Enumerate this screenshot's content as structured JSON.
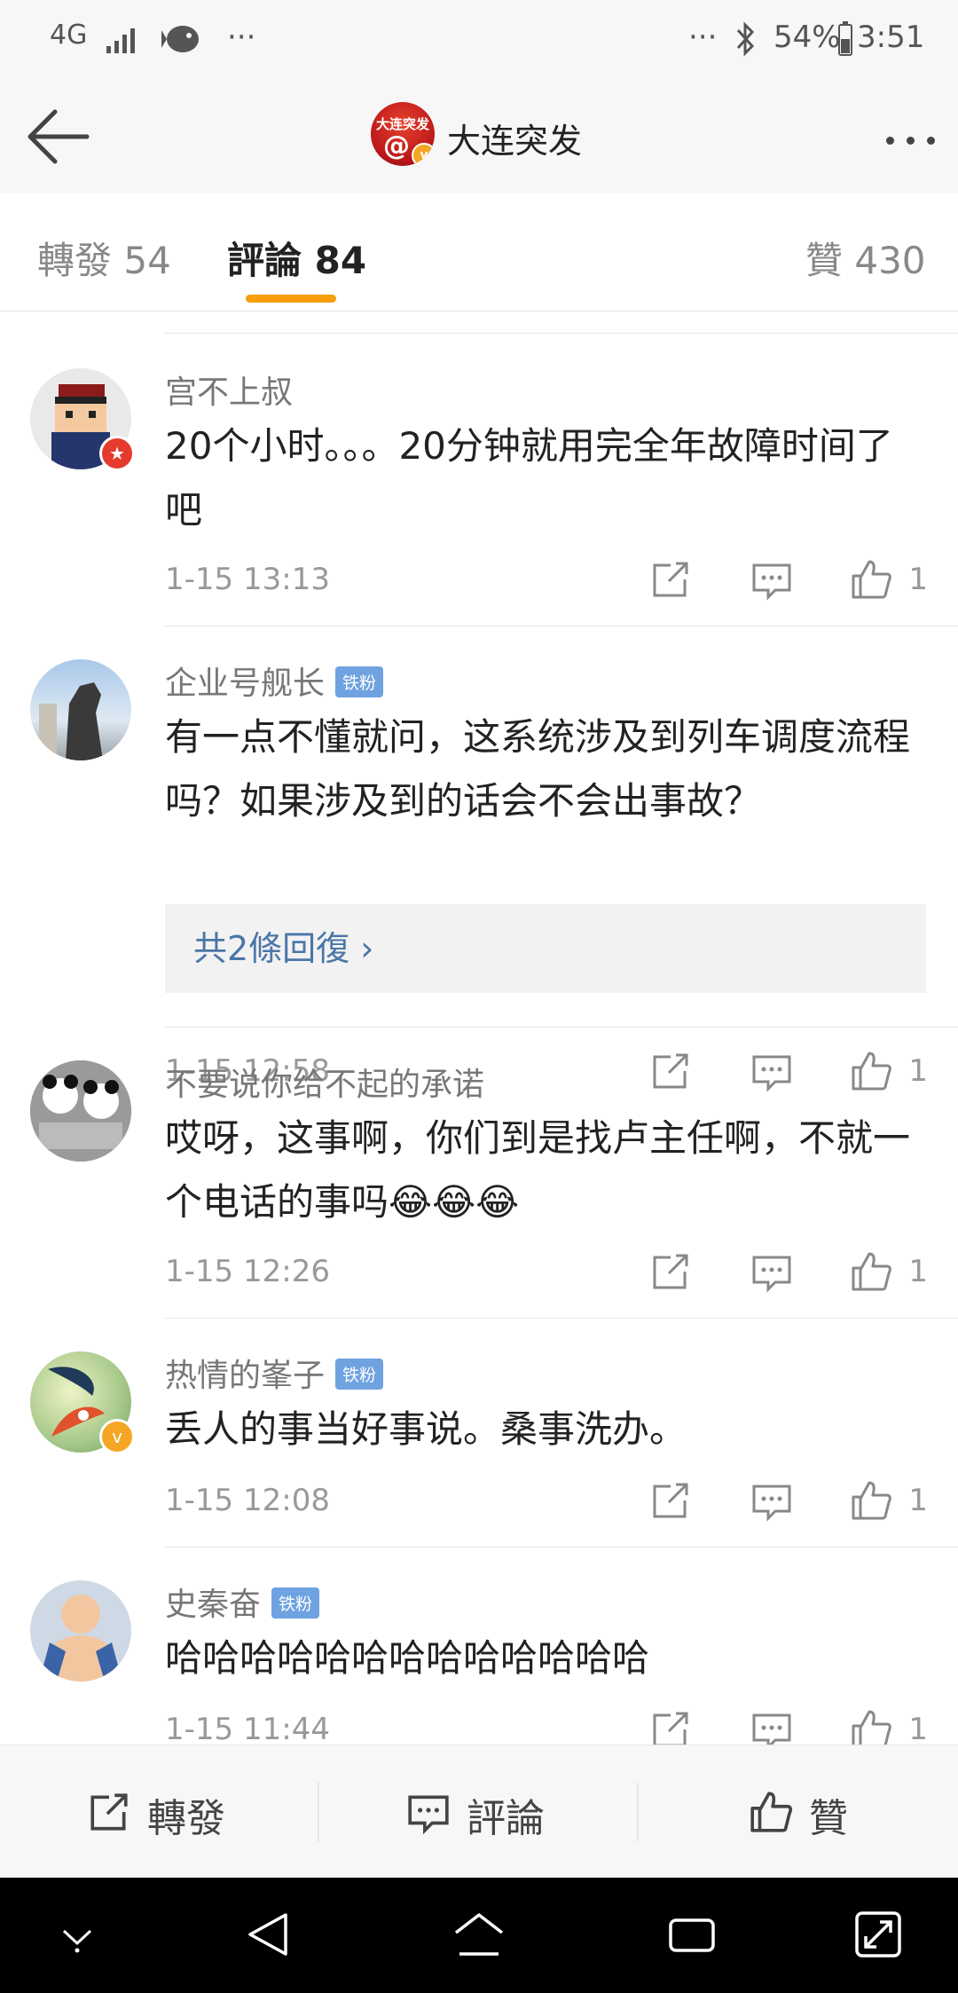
{
  "status_bar": {
    "network": "4G",
    "more_left": "···",
    "more_right": "···",
    "battery": "54%",
    "time": "3:51"
  },
  "header": {
    "account_avatar_text": "大连突发",
    "account_name": "大连突发"
  },
  "tabs": {
    "reposts": "轉發 54",
    "comments": "評論 84",
    "likes": "贊 430"
  },
  "comments": [
    {
      "user": "宫不上叔",
      "fan_badge": "",
      "text": "20个小时。。。20分钟就用完全年故障时间了吧",
      "time": "1-15 13:13",
      "likes": "1"
    },
    {
      "user": "企业号舰长",
      "fan_badge": "铁粉",
      "text": "有一点不懂就问，这系统涉及到列车调度流程吗？如果涉及到的话会不会出事故？",
      "replies": "共2條回復",
      "time": "1-15 12:58",
      "likes": "1"
    },
    {
      "user": "不要说你给不起的承诺",
      "fan_badge": "",
      "text": "哎呀，这事啊，你们到是找卢主任啊，不就一个电话的事吗😂😂😂",
      "time": "1-15 12:26",
      "likes": "1"
    },
    {
      "user": "热情的峯子",
      "fan_badge": "铁粉",
      "text": "丢人的事当好事说。桑事洗办。",
      "time": "1-15 12:08",
      "likes": "1"
    },
    {
      "user": "史秦奋",
      "fan_badge": "铁粉",
      "text": "哈哈哈哈哈哈哈哈哈哈哈哈哈",
      "time": "1-15 11:44",
      "likes": "1"
    }
  ],
  "bottom_bar": {
    "repost": "轉發",
    "comment": "評論",
    "like": "贊"
  }
}
